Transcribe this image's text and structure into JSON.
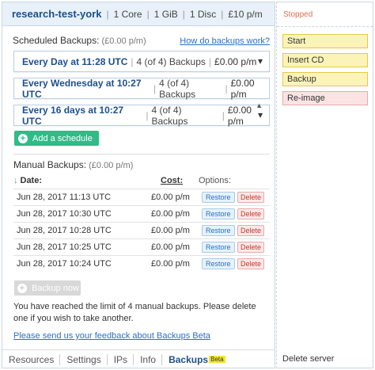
{
  "server": {
    "name": "research-test-york",
    "cores": "1 Core",
    "ram": "1 GiB",
    "disc": "1 Disc",
    "price": "£10 p/m"
  },
  "scheduled": {
    "title": "Scheduled Backups:",
    "cost": "(£0.00 p/m)",
    "help_link": "How do backups work?",
    "schedules": [
      {
        "when": "Every Day at 11:28 UTC",
        "count": "4 (of 4) Backups",
        "cost": "£0.00 p/m"
      },
      {
        "when": "Every Wednesday at 10:27 UTC",
        "count": "4 (of 4) Backups",
        "cost": "£0.00 p/m"
      },
      {
        "when": "Every 16 days at 10:27 UTC",
        "count": "4 (of 4) Backups",
        "cost": "£0.00 p/m"
      }
    ],
    "add_label": "Add a schedule"
  },
  "manual": {
    "title": "Manual Backups:",
    "cost": "(£0.00 p/m)",
    "columns": {
      "date": "Date:",
      "cost": "Cost:",
      "options": "Options:"
    },
    "rows": [
      {
        "date": "Jun 28, 2017 11:13 UTC",
        "cost": "£0.00 p/m"
      },
      {
        "date": "Jun 28, 2017 10:30 UTC",
        "cost": "£0.00 p/m"
      },
      {
        "date": "Jun 28, 2017 10:28 UTC",
        "cost": "£0.00 p/m"
      },
      {
        "date": "Jun 28, 2017 10:25 UTC",
        "cost": "£0.00 p/m"
      },
      {
        "date": "Jun 28, 2017 10:24 UTC",
        "cost": "£0.00 p/m"
      }
    ],
    "restore_label": "Restore",
    "delete_label": "Delete",
    "backup_now_label": "Backup now",
    "limit_message": "You have reached the limit of 4 manual backups. Please delete one if you wish to take another.",
    "feedback_link": "Please send us your feedback about Backups Beta"
  },
  "tabs": [
    {
      "label": "Resources"
    },
    {
      "label": "Settings"
    },
    {
      "label": "IPs"
    },
    {
      "label": "Info"
    },
    {
      "label": "Backups",
      "badge": "Beta",
      "active": true
    }
  ],
  "sidebar": {
    "status": "Stopped",
    "actions": [
      "Start",
      "Insert CD",
      "Backup",
      "Re-image"
    ],
    "delete_server": "Delete server"
  },
  "colors": {
    "accent": "#2ebc87",
    "link": "#2a6fc9",
    "title": "#1d4f8c",
    "status": "#e26d4f"
  }
}
